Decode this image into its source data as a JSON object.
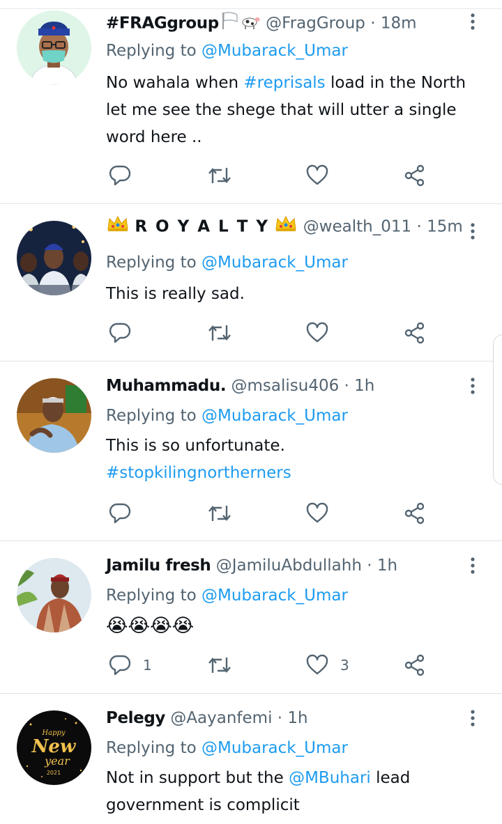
{
  "tweets": [
    {
      "display_name": "#FRAGgroup",
      "handle": "@FragGroup",
      "separator": "·",
      "time": "18m",
      "replying_prefix": "Replying to",
      "replying_to": "@Mubarack_Umar",
      "text_parts": [
        {
          "text": "No wahala when ",
          "link": false
        },
        {
          "text": "#reprisals",
          "link": true
        },
        {
          "text": " load in the North let me see the shege that will utter a single word here ..",
          "link": false
        }
      ],
      "reply_count": "",
      "like_count": ""
    },
    {
      "display_name": "R O Y A L T Y",
      "handle": "@wealth_011",
      "separator": "·",
      "time": "15m",
      "replying_prefix": "Replying to",
      "replying_to": "@Mubarack_Umar",
      "text_parts": [
        {
          "text": "This is really sad.",
          "link": false
        }
      ],
      "reply_count": "",
      "like_count": ""
    },
    {
      "display_name": "Muhammadu.",
      "handle": "@msalisu406",
      "separator": "·",
      "time": "1h",
      "replying_prefix": "Replying to",
      "replying_to": "@Mubarack_Umar",
      "text_parts": [
        {
          "text": "This is so unfortunate.",
          "link": false
        },
        {
          "text": "#stopkilingnortherners",
          "link": true,
          "newline": true
        }
      ],
      "reply_count": "",
      "like_count": ""
    },
    {
      "display_name": "Jamilu fresh",
      "handle": "@JamiluAbdullahh",
      "separator": "·",
      "time": "1h",
      "replying_prefix": "Replying to",
      "replying_to": "@Mubarack_Umar",
      "text_parts": [
        {
          "text": "😭😭😭😭",
          "link": false
        }
      ],
      "reply_count": "1",
      "like_count": "3"
    },
    {
      "display_name": "Pelegy",
      "handle": "@Aayanfemi",
      "separator": "·",
      "time": "1h",
      "replying_prefix": "Replying to",
      "replying_to": "@Mubarack_Umar",
      "text_parts": [
        {
          "text": "Not in support but the ",
          "link": false
        },
        {
          "text": "@MBuhari",
          "link": true
        },
        {
          "text": " lead government is complicit",
          "link": false
        }
      ],
      "reply_count": "",
      "like_count": ""
    }
  ],
  "avatar_texts": {
    "pelegy_line1": "Happy",
    "pelegy_line2": "New",
    "pelegy_line3": "year",
    "pelegy_line4": "2021"
  },
  "icons": {
    "more": "more-vertical-icon",
    "reply": "reply-bubble-icon",
    "retweet": "retweet-icon",
    "like": "heart-icon",
    "share": "share-icon",
    "flag": "white-flag-emoji",
    "cow": "cow-emoji",
    "crown": "crown-emoji"
  },
  "colors": {
    "accent": "#1d9bf0",
    "secondary_text": "#536471",
    "icon": "#536471",
    "divider": "#dfe3e6"
  }
}
